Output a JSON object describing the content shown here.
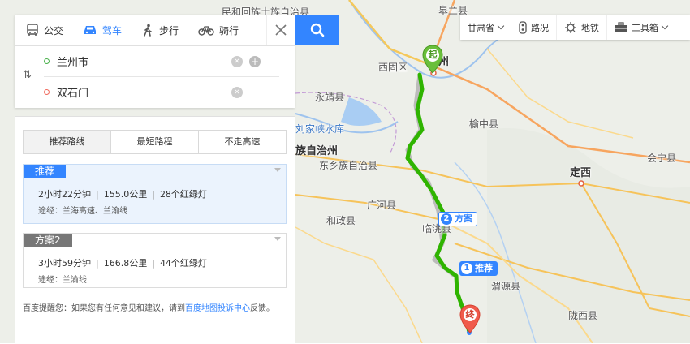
{
  "modes": {
    "bus": "公交",
    "drive": "驾车",
    "walk": "步行",
    "bike": "骑行"
  },
  "inputs": {
    "origin": "兰州市",
    "destination": "双石门"
  },
  "route_tabs": [
    "推荐路线",
    "最短路程",
    "不走高速"
  ],
  "plans": [
    {
      "badge": "推荐",
      "time": "2小时22分钟",
      "distance": "155.0公里",
      "lights": "28个红绿灯",
      "via": "途经：兰海高速、兰渝线"
    },
    {
      "badge": "方案2",
      "time": "3小时59分钟",
      "distance": "166.8公里",
      "lights": "44个红绿灯",
      "via": "途经：兰渝线"
    }
  ],
  "tip": {
    "prefix": "百度提醒您：如果您有任何意见和建议，请到",
    "link": "百度地图投诉中心",
    "suffix": "反馈。"
  },
  "toolbar": {
    "province": "甘肃省",
    "traffic": "路况",
    "subway": "地铁",
    "tools": "工具箱"
  },
  "map": {
    "labels": [
      "民和回族土族自治县",
      "皋兰县",
      "兰州",
      "西固区",
      "永靖县",
      "刘家峡水库",
      "榆中县",
      "族自治州",
      "东乡族自治县",
      "定西",
      "会宁县",
      "广河县",
      "和政县",
      "临洮县",
      "渭源县",
      "陇西县"
    ],
    "start_marker": "起",
    "end_marker": "终",
    "plan1_tag": "推荐",
    "plan1_num": "1",
    "plan2_tag": "方案",
    "plan2_num": "2"
  },
  "colors": {
    "accent": "#3385ff",
    "route_green": "#2fb400",
    "start_green": "#6abf3b",
    "end_red": "#f05a4b"
  }
}
